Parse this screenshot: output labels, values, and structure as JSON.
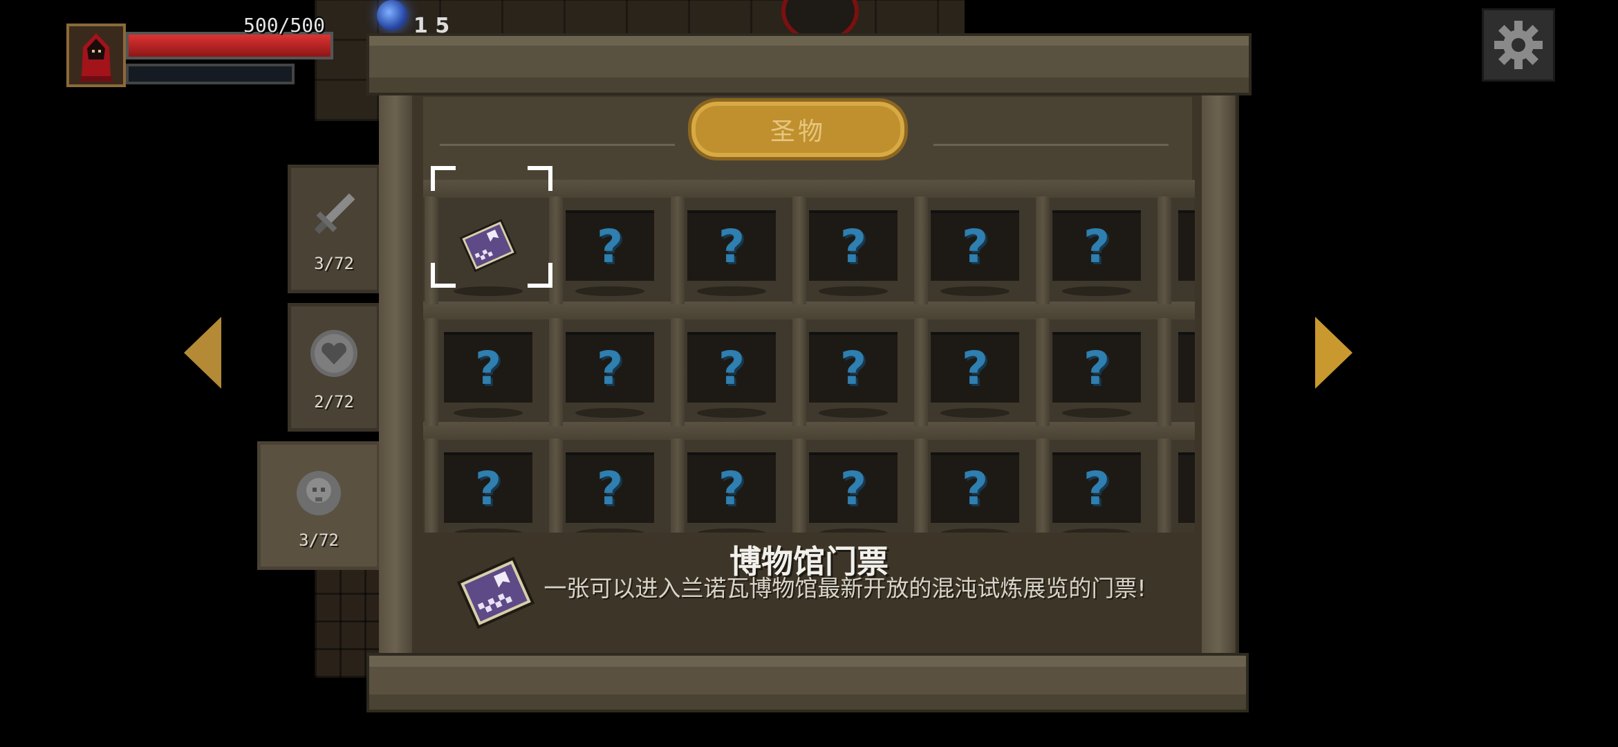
{
  "hud": {
    "hp_text": "500/500",
    "hp_fraction": 1.0,
    "hp_color": "#c82424",
    "orb_partial_text": "1 5",
    "settings_icon": "gear-icon"
  },
  "navigation": {
    "prev_icon": "triangle-left-icon",
    "next_icon": "triangle-right-icon",
    "arrow_color": "#c9992f"
  },
  "tabs": [
    {
      "icon": "sword-icon",
      "count": "3/72",
      "active": false
    },
    {
      "icon": "shield-heart-icon",
      "count": "2/72",
      "active": false
    },
    {
      "icon": "skull-relic-icon",
      "count": "3/72",
      "active": true
    }
  ],
  "cabinet": {
    "title": "圣物",
    "rows": [
      [
        "museum-ticket-icon",
        "?",
        "?",
        "?",
        "?",
        "?"
      ],
      [
        "?",
        "?",
        "?",
        "?",
        "?",
        "?"
      ],
      [
        "?",
        "?",
        "?",
        "?",
        "?",
        "?"
      ]
    ],
    "selected_slot": 0,
    "unknown_color": "#2f7fb0"
  },
  "selected_item": {
    "icon": "museum-ticket-icon",
    "name": "博物馆门票",
    "description": "一张可以进入兰诺瓦博物馆最新开放的混沌试炼展览的门票!"
  }
}
